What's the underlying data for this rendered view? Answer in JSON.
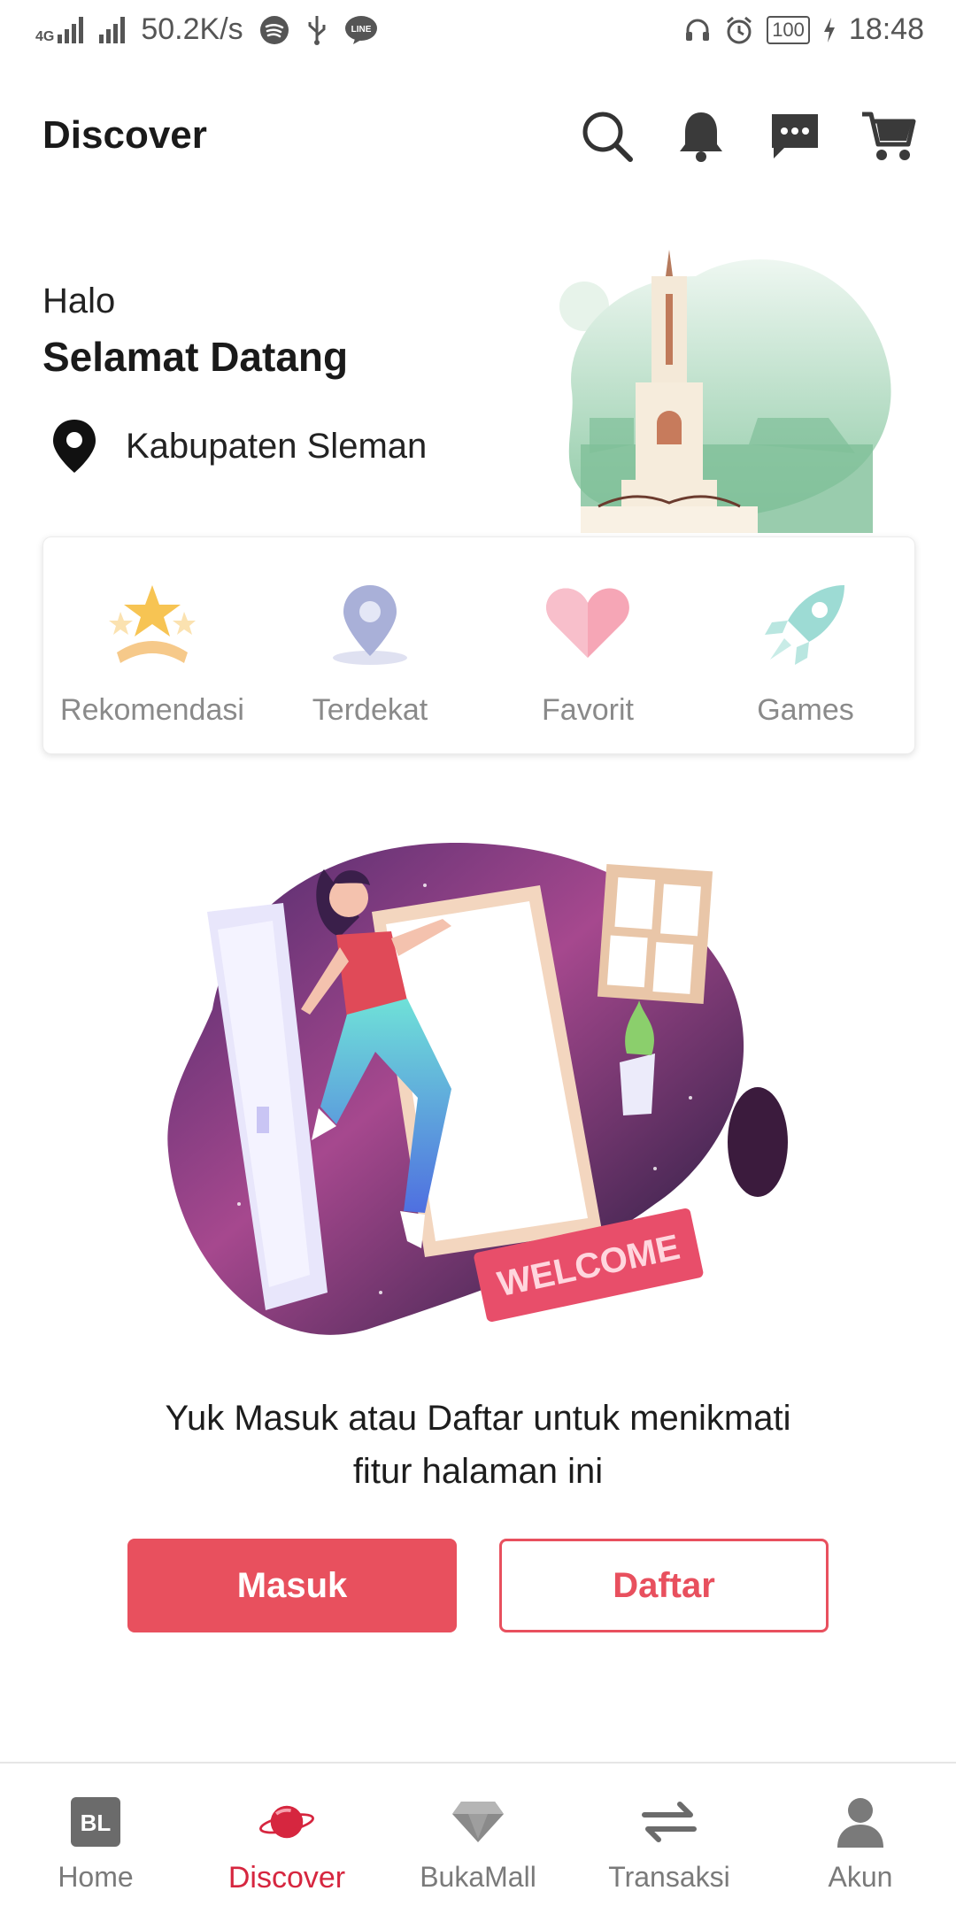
{
  "status_bar": {
    "network_type": "4G",
    "speed": "50.2K/s",
    "battery": "100",
    "time": "18:48"
  },
  "header": {
    "title": "Discover",
    "icons": [
      "search-icon",
      "bell-icon",
      "chat-icon",
      "cart-icon"
    ]
  },
  "hero": {
    "greeting": "Halo",
    "welcome": "Selamat Datang",
    "location": "Kabupaten Sleman"
  },
  "categories": [
    {
      "label": "Rekomendasi",
      "icon": "star-award-icon"
    },
    {
      "label": "Terdekat",
      "icon": "location-pin-icon"
    },
    {
      "label": "Favorit",
      "icon": "heart-icon"
    },
    {
      "label": "Games",
      "icon": "rocket-icon"
    }
  ],
  "prompt": {
    "line1": "Yuk Masuk atau Daftar untuk menikmati",
    "line2": "fitur halaman ini"
  },
  "buttons": {
    "login": "Masuk",
    "register": "Daftar"
  },
  "illustration": {
    "mat_text": "WELCOME"
  },
  "bottom_nav": [
    {
      "label": "Home",
      "icon": "bl-logo-icon"
    },
    {
      "label": "Discover",
      "icon": "planet-icon",
      "active": true
    },
    {
      "label": "BukaMall",
      "icon": "diamond-icon"
    },
    {
      "label": "Transaksi",
      "icon": "swap-arrows-icon"
    },
    {
      "label": "Akun",
      "icon": "user-icon"
    }
  ],
  "colors": {
    "accent": "#e8505e",
    "nav_active": "#d6263f",
    "muted_text": "#8a8a8a"
  }
}
